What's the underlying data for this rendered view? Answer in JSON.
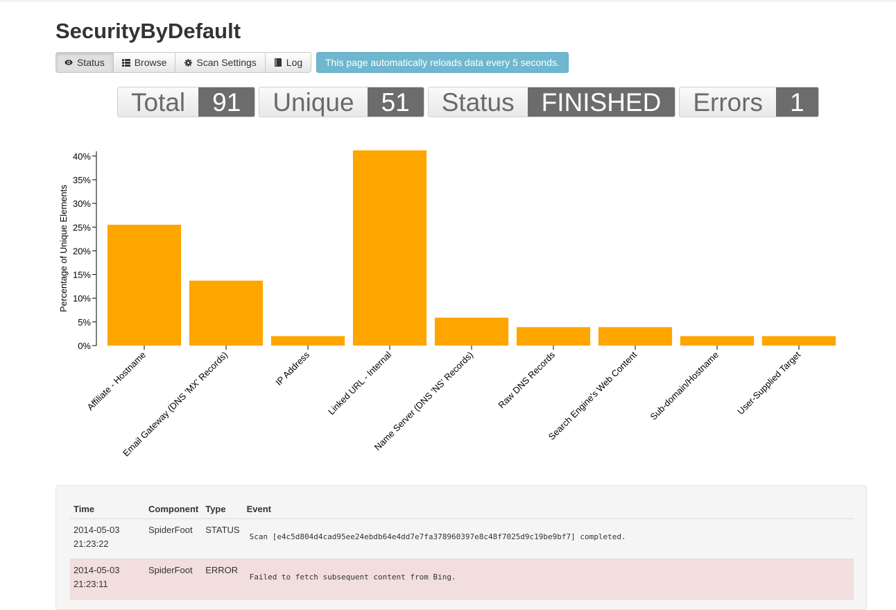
{
  "page": {
    "title": "SecurityByDefault"
  },
  "toolbar": {
    "buttons": [
      {
        "label": "Status",
        "icon": "eye-icon"
      },
      {
        "label": "Browse",
        "icon": "list-icon"
      },
      {
        "label": "Scan Settings",
        "icon": "gear-icon"
      },
      {
        "label": "Log",
        "icon": "book-icon"
      }
    ],
    "active_index": 0,
    "reload_note": "This page automatically reloads data every 5 seconds."
  },
  "stats": [
    {
      "label": "Total",
      "value": "91"
    },
    {
      "label": "Unique",
      "value": "51"
    },
    {
      "label": "Status",
      "value": "FINISHED"
    },
    {
      "label": "Errors",
      "value": "1"
    }
  ],
  "chart_data": {
    "type": "bar",
    "title": "",
    "xlabel": "",
    "ylabel": "Percentage of Unique Elements",
    "ylim": [
      0,
      41
    ],
    "yticks": [
      "0%",
      "5%",
      "10%",
      "15%",
      "20%",
      "25%",
      "30%",
      "35%",
      "40%"
    ],
    "categories": [
      "Affiliate - Hostname",
      "Email Gateway (DNS 'MX' Records)",
      "IP Address",
      "Linked URL - Internal",
      "Name Server (DNS 'NS' Records)",
      "Raw DNS Records",
      "Search Engine's Web Content",
      "Sub-domain/Hostname",
      "User-Supplied Target"
    ],
    "values": [
      25.5,
      13.7,
      2.0,
      41.2,
      5.9,
      3.9,
      3.9,
      2.0,
      2.0
    ],
    "bar_color": "#ffa500",
    "grid": false
  },
  "log": {
    "headers": [
      "Time",
      "Component",
      "Type",
      "Event"
    ],
    "rows": [
      {
        "date": "2014-05-03",
        "time": "21:23:22",
        "component": "SpiderFoot",
        "type": "STATUS",
        "event": "Scan [e4c5d804d4cad95ee24ebdb64e4dd7e7fa378960397e8c48f7025d9c19be9bf7] completed.",
        "error": false
      },
      {
        "date": "2014-05-03",
        "time": "21:23:11",
        "component": "SpiderFoot",
        "type": "ERROR",
        "event": "Failed to fetch subsequent content from Bing.",
        "error": true
      }
    ]
  }
}
